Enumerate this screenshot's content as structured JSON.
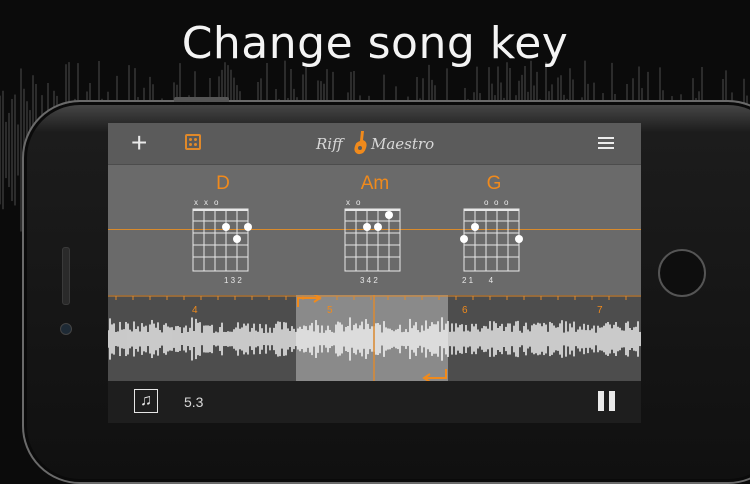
{
  "headline": "Change song key",
  "app": {
    "logo_word1": "Riff",
    "logo_word2": "Maestro",
    "accent_color": "#f08a1c"
  },
  "toolbar": {
    "add_icon": "+",
    "random_icon": "dice-icon",
    "menu_icon": "hamburger-menu-icon"
  },
  "chords": [
    {
      "name": "D",
      "top_marks": "x x o",
      "fingering": "1 3 2"
    },
    {
      "name": "Am",
      "top_marks": "x o",
      "fingering": "3 4 2"
    },
    {
      "name": "G",
      "top_marks": "o o o",
      "fingering": "2 1       4"
    }
  ],
  "timeline": {
    "bar_numbers": [
      "4",
      "5",
      "6",
      "7"
    ]
  },
  "bottom": {
    "position_label": "5.3",
    "song_icon": "music-note-icon",
    "pause_icon": "pause-icon"
  }
}
